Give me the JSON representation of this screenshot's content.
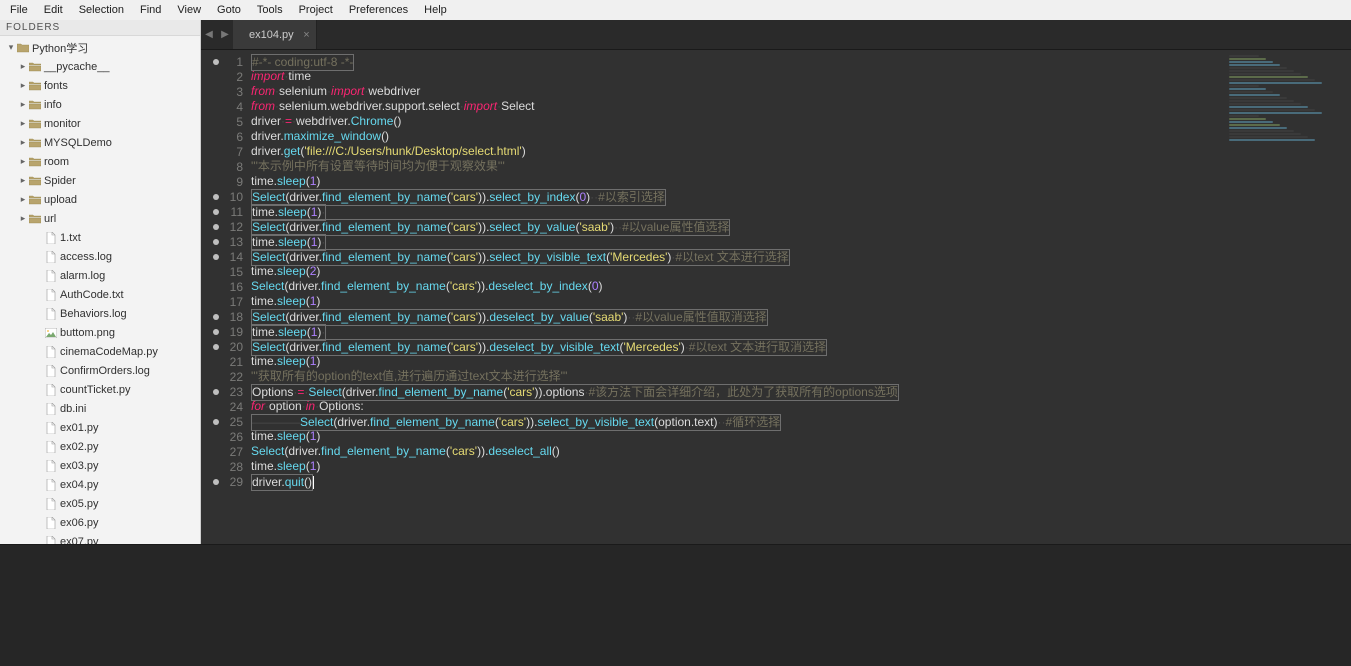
{
  "menu": [
    "File",
    "Edit",
    "Selection",
    "Find",
    "View",
    "Goto",
    "Tools",
    "Project",
    "Preferences",
    "Help"
  ],
  "sidebar": {
    "header": "FOLDERS",
    "root": "Python学习",
    "treeFolders": [
      "__pycache__",
      "fonts",
      "info",
      "monitor",
      "MYSQLDemo",
      "room",
      "Spider",
      "upload",
      "url"
    ],
    "treeFiles": [
      {
        "name": "1.txt",
        "type": "file"
      },
      {
        "name": "access.log",
        "type": "file"
      },
      {
        "name": "alarm.log",
        "type": "file"
      },
      {
        "name": "AuthCode.txt",
        "type": "file"
      },
      {
        "name": "Behaviors.log",
        "type": "file"
      },
      {
        "name": "buttom.png",
        "type": "image"
      },
      {
        "name": "cinemaCodeMap.py",
        "type": "file"
      },
      {
        "name": "ConfirmOrders.log",
        "type": "file"
      },
      {
        "name": "countTicket.py",
        "type": "file"
      },
      {
        "name": "db.ini",
        "type": "file"
      },
      {
        "name": "ex01.py",
        "type": "file"
      },
      {
        "name": "ex02.py",
        "type": "file"
      },
      {
        "name": "ex03.py",
        "type": "file"
      },
      {
        "name": "ex04.py",
        "type": "file"
      },
      {
        "name": "ex05.py",
        "type": "file"
      },
      {
        "name": "ex06.py",
        "type": "file"
      },
      {
        "name": "ex07.py",
        "type": "file"
      }
    ]
  },
  "tabs": {
    "active": "ex104.py"
  },
  "gutter": {
    "modified": [
      1,
      10,
      11,
      12,
      13,
      14,
      18,
      19,
      20,
      23,
      25,
      29
    ]
  },
  "code": [
    {
      "ln": 1,
      "boxed": true,
      "tokens": [
        [
          "cmt",
          "#-*- coding:utf-8 -*-"
        ]
      ]
    },
    {
      "ln": 2,
      "boxed": false,
      "tokens": [
        [
          "kw",
          "import"
        ],
        [
          "ws",
          "·"
        ],
        [
          "",
          "time"
        ]
      ]
    },
    {
      "ln": 3,
      "boxed": false,
      "tokens": [
        [
          "kw",
          "from"
        ],
        [
          "ws",
          "·"
        ],
        [
          "",
          "selenium"
        ],
        [
          "ws",
          "·"
        ],
        [
          "kw",
          "import"
        ],
        [
          "ws",
          "·"
        ],
        [
          "",
          "webdriver"
        ]
      ]
    },
    {
      "ln": 4,
      "boxed": false,
      "tokens": [
        [
          "kw",
          "from"
        ],
        [
          "ws",
          "·"
        ],
        [
          "",
          "selenium.webdriver.support.select"
        ],
        [
          "ws",
          "·"
        ],
        [
          "kw",
          "import"
        ],
        [
          "ws",
          "·"
        ],
        [
          "",
          "Select"
        ]
      ]
    },
    {
      "ln": 5,
      "boxed": false,
      "tokens": [
        [
          "",
          "driver"
        ],
        [
          "ws",
          "·"
        ],
        [
          "op",
          "="
        ],
        [
          "ws",
          "·"
        ],
        [
          "",
          "webdriver."
        ],
        [
          "fn",
          "Chrome"
        ],
        [
          "",
          "()"
        ]
      ]
    },
    {
      "ln": 6,
      "boxed": false,
      "tokens": [
        [
          "",
          "driver."
        ],
        [
          "fn",
          "maximize_window"
        ],
        [
          "",
          "()"
        ]
      ]
    },
    {
      "ln": 7,
      "boxed": false,
      "tokens": [
        [
          "",
          "driver."
        ],
        [
          "fn",
          "get"
        ],
        [
          "",
          "("
        ],
        [
          "str",
          "'file:///C:/Users/hunk/Desktop/select.html'"
        ],
        [
          "",
          ")"
        ]
      ]
    },
    {
      "ln": 8,
      "boxed": false,
      "tokens": [
        [
          "cmt",
          "'''本示例中所有设置等待时间均为便于观察效果'''"
        ]
      ]
    },
    {
      "ln": 9,
      "boxed": false,
      "tokens": [
        [
          "",
          "time."
        ],
        [
          "fn",
          "sleep"
        ],
        [
          "",
          "("
        ],
        [
          "num",
          "1"
        ],
        [
          "",
          ")"
        ]
      ]
    },
    {
      "ln": 10,
      "boxed": true,
      "tokens": [
        [
          "fn",
          "Select"
        ],
        [
          "",
          "(driver."
        ],
        [
          "fn",
          "find_element_by_name"
        ],
        [
          "",
          "("
        ],
        [
          "str",
          "'cars'"
        ],
        [
          "",
          "))."
        ],
        [
          "fn",
          "select_by_index"
        ],
        [
          "",
          "("
        ],
        [
          "num",
          "0"
        ],
        [
          "",
          ")"
        ],
        [
          "ws",
          "··"
        ],
        [
          "cmt",
          "#以索引选择"
        ]
      ]
    },
    {
      "ln": 11,
      "boxed": true,
      "tokens": [
        [
          "",
          "time."
        ],
        [
          "fn",
          "sleep"
        ],
        [
          "",
          "("
        ],
        [
          "num",
          "1"
        ],
        [
          "",
          ")"
        ],
        [
          "ws",
          "·"
        ]
      ]
    },
    {
      "ln": 12,
      "boxed": true,
      "tokens": [
        [
          "fn",
          "Select"
        ],
        [
          "",
          "(driver."
        ],
        [
          "fn",
          "find_element_by_name"
        ],
        [
          "",
          "("
        ],
        [
          "str",
          "'cars'"
        ],
        [
          "",
          "))."
        ],
        [
          "fn",
          "select_by_value"
        ],
        [
          "",
          "("
        ],
        [
          "str",
          "'saab'"
        ],
        [
          "",
          ")"
        ],
        [
          "ws",
          "··"
        ],
        [
          "cmt",
          "#以value属性值选择"
        ]
      ]
    },
    {
      "ln": 13,
      "boxed": true,
      "tokens": [
        [
          "",
          "time."
        ],
        [
          "fn",
          "sleep"
        ],
        [
          "",
          "("
        ],
        [
          "num",
          "1"
        ],
        [
          "",
          ")"
        ],
        [
          "ws",
          "·"
        ]
      ]
    },
    {
      "ln": 14,
      "boxed": true,
      "tokens": [
        [
          "fn",
          "Select"
        ],
        [
          "",
          "(driver."
        ],
        [
          "fn",
          "find_element_by_name"
        ],
        [
          "",
          "("
        ],
        [
          "str",
          "'cars'"
        ],
        [
          "",
          "))."
        ],
        [
          "fn",
          "select_by_visible_text"
        ],
        [
          "",
          "("
        ],
        [
          "str",
          "'Mercedes'"
        ],
        [
          "",
          ")"
        ],
        [
          "ws",
          "·"
        ],
        [
          "cmt",
          "#以text 文本进行选择"
        ]
      ]
    },
    {
      "ln": 15,
      "boxed": false,
      "tokens": [
        [
          "",
          "time."
        ],
        [
          "fn",
          "sleep"
        ],
        [
          "",
          "("
        ],
        [
          "num",
          "2"
        ],
        [
          "",
          ")"
        ]
      ]
    },
    {
      "ln": 16,
      "boxed": false,
      "tokens": [
        [
          "fn",
          "Select"
        ],
        [
          "",
          "(driver."
        ],
        [
          "fn",
          "find_element_by_name"
        ],
        [
          "",
          "("
        ],
        [
          "str",
          "'cars'"
        ],
        [
          "",
          "))."
        ],
        [
          "fn",
          "deselect_by_index"
        ],
        [
          "",
          "("
        ],
        [
          "num",
          "0"
        ],
        [
          "",
          ")"
        ]
      ]
    },
    {
      "ln": 17,
      "boxed": false,
      "tokens": [
        [
          "",
          "time."
        ],
        [
          "fn",
          "sleep"
        ],
        [
          "",
          "("
        ],
        [
          "num",
          "1"
        ],
        [
          "",
          ")"
        ]
      ]
    },
    {
      "ln": 18,
      "boxed": true,
      "tokens": [
        [
          "fn",
          "Select"
        ],
        [
          "",
          "(driver."
        ],
        [
          "fn",
          "find_element_by_name"
        ],
        [
          "",
          "("
        ],
        [
          "str",
          "'cars'"
        ],
        [
          "",
          "))."
        ],
        [
          "fn",
          "deselect_by_value"
        ],
        [
          "",
          "("
        ],
        [
          "str",
          "'saab'"
        ],
        [
          "",
          ")"
        ],
        [
          "ws",
          "··"
        ],
        [
          "cmt",
          "#以value属性值取消选择"
        ]
      ]
    },
    {
      "ln": 19,
      "boxed": true,
      "tokens": [
        [
          "",
          "time."
        ],
        [
          "fn",
          "sleep"
        ],
        [
          "",
          "("
        ],
        [
          "num",
          "1"
        ],
        [
          "",
          ")"
        ],
        [
          "ws",
          "·"
        ]
      ]
    },
    {
      "ln": 20,
      "boxed": true,
      "tokens": [
        [
          "fn",
          "Select"
        ],
        [
          "",
          "(driver."
        ],
        [
          "fn",
          "find_element_by_name"
        ],
        [
          "",
          "("
        ],
        [
          "str",
          "'cars'"
        ],
        [
          "",
          "))."
        ],
        [
          "fn",
          "deselect_by_visible_text"
        ],
        [
          "",
          "("
        ],
        [
          "str",
          "'Mercedes'"
        ],
        [
          "",
          ")"
        ],
        [
          "ws",
          "·"
        ],
        [
          "cmt",
          "#以text 文本进行取消选择"
        ]
      ]
    },
    {
      "ln": 21,
      "boxed": false,
      "tokens": [
        [
          "",
          "time."
        ],
        [
          "fn",
          "sleep"
        ],
        [
          "",
          "("
        ],
        [
          "num",
          "1"
        ],
        [
          "",
          ")"
        ]
      ]
    },
    {
      "ln": 22,
      "boxed": false,
      "tokens": [
        [
          "cmt",
          "'''获取所有的option的text值,进行遍历通过text文本进行选择'''"
        ]
      ]
    },
    {
      "ln": 23,
      "boxed": true,
      "tokens": [
        [
          "",
          "Options"
        ],
        [
          "ws",
          "·"
        ],
        [
          "op",
          "="
        ],
        [
          "ws",
          "·"
        ],
        [
          "fn",
          "Select"
        ],
        [
          "",
          "(driver."
        ],
        [
          "fn",
          "find_element_by_name"
        ],
        [
          "",
          "("
        ],
        [
          "str",
          "'cars'"
        ],
        [
          "",
          ")).options"
        ],
        [
          "ws",
          "·"
        ],
        [
          "cmt",
          "#该方法下面会详细介绍，此处为了获取所有的options选项"
        ]
      ]
    },
    {
      "ln": 24,
      "boxed": false,
      "tokens": [
        [
          "kw",
          "for"
        ],
        [
          "ws",
          "·"
        ],
        [
          "",
          "option"
        ],
        [
          "ws",
          "·"
        ],
        [
          "kw",
          "in"
        ],
        [
          "ws",
          "·"
        ],
        [
          "",
          "Options:"
        ]
      ]
    },
    {
      "ln": 25,
      "boxed": true,
      "tokens": [
        [
          "ws",
          "————"
        ],
        [
          "fn",
          "Select"
        ],
        [
          "",
          "(driver."
        ],
        [
          "fn",
          "find_element_by_name"
        ],
        [
          "",
          "("
        ],
        [
          "str",
          "'cars'"
        ],
        [
          "",
          "))."
        ],
        [
          "fn",
          "select_by_visible_text"
        ],
        [
          "",
          "(option.text)"
        ],
        [
          "ws",
          "··"
        ],
        [
          "cmt",
          "#循环选择"
        ]
      ]
    },
    {
      "ln": 26,
      "boxed": false,
      "tokens": [
        [
          "",
          "time."
        ],
        [
          "fn",
          "sleep"
        ],
        [
          "",
          "("
        ],
        [
          "num",
          "1"
        ],
        [
          "",
          ")"
        ]
      ]
    },
    {
      "ln": 27,
      "boxed": false,
      "tokens": [
        [
          "fn",
          "Select"
        ],
        [
          "",
          "(driver."
        ],
        [
          "fn",
          "find_element_by_name"
        ],
        [
          "",
          "("
        ],
        [
          "str",
          "'cars'"
        ],
        [
          "",
          "))."
        ],
        [
          "fn",
          "deselect_all"
        ],
        [
          "",
          "()"
        ]
      ]
    },
    {
      "ln": 28,
      "boxed": false,
      "tokens": [
        [
          "",
          "time."
        ],
        [
          "fn",
          "sleep"
        ],
        [
          "",
          "("
        ],
        [
          "num",
          "1"
        ],
        [
          "",
          ")"
        ]
      ]
    },
    {
      "ln": 29,
      "boxed": true,
      "tokens": [
        [
          "",
          "driver."
        ],
        [
          "fn",
          "quit"
        ],
        [
          "",
          "()"
        ]
      ]
    }
  ]
}
